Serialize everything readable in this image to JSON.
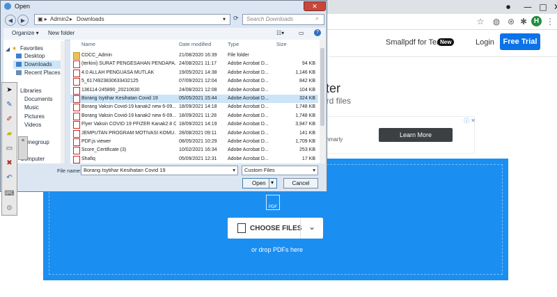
{
  "browser": {
    "window_controls": [
      "—",
      "□",
      "✕"
    ],
    "toolbar_icons": [
      "star-icon",
      "globe-icon",
      "extension-icon",
      "puzzle-icon",
      "menu-icon"
    ],
    "profile_initial": "H"
  },
  "site": {
    "teams_link": "Smallpdf for Teams",
    "new_badge": "New",
    "login": "Login",
    "free_trial": "Free Trial",
    "hero_title": "rter",
    "hero_subtitle": "ord files",
    "ad_text": "mmarly",
    "ad_badge": "ⓘ ✕",
    "learn_more": "Learn More",
    "pdf_glyph_label": "PDF",
    "choose_files": "CHOOSE FILES",
    "drop_hint": "or drop PDFs here",
    "accent_color": "#1b8ef2",
    "trial_color": "#0b72e7"
  },
  "dialog": {
    "title": "Open",
    "close": "✕",
    "address": [
      "Admin2",
      "Downloads"
    ],
    "search_placeholder": "Search Downloads",
    "organize": "Organize ▾",
    "new_folder": "New folder",
    "nav": [
      "Favorites",
      "Desktop",
      "Downloads",
      "Recent Places",
      "Libraries",
      "Documents",
      "Music",
      "Pictures",
      "Videos",
      "Homegroup",
      "Computer"
    ],
    "columns": [
      "Name",
      "Date modified",
      "Type",
      "Size"
    ],
    "files": [
      {
        "name": "CDCC_Admin",
        "date": "21/08/2020 16:39",
        "type": "File folder",
        "size": "",
        "kind": "folder"
      },
      {
        "name": "(terkini) SURAT PENGESAHAN PENDAPA...",
        "date": "24/08/2021 11:17",
        "type": "Adobe Acrobat D...",
        "size": "94 KB",
        "kind": "pdf"
      },
      {
        "name": "4.0 ALLAH PENGUASA MUTLAK",
        "date": "19/05/2021 14:38",
        "type": "Adobe Acrobat D...",
        "size": "1,146 KB",
        "kind": "pdf"
      },
      {
        "name": "5_6174923830633432125",
        "date": "07/09/2021 12:04",
        "type": "Adobe Acrobat D...",
        "size": "842 KB",
        "kind": "pdf"
      },
      {
        "name": "136114-245890_20210630",
        "date": "24/08/2021 12:08",
        "type": "Adobe Acrobat D...",
        "size": "104 KB",
        "kind": "pdf"
      },
      {
        "name": "Borang Isytihar Kesihatan Covid 19",
        "date": "05/05/2021 15:44",
        "type": "Adobe Acrobat D...",
        "size": "324 KB",
        "kind": "pdf",
        "selected": true
      },
      {
        "name": "Borang Vaksin Covid-19 kanak2 new 6-09...",
        "date": "18/09/2021 14:18",
        "type": "Adobe Acrobat D...",
        "size": "1,748 KB",
        "kind": "pdf"
      },
      {
        "name": "Borang Vaksin Covid-19 kanak2 new 6-09...",
        "date": "18/09/2021 11:28",
        "type": "Adobe Acrobat D...",
        "size": "1,748 KB",
        "kind": "pdf"
      },
      {
        "name": "Flyer Vaksin COVID 19 PFIZER Kanak2 8 O...",
        "date": "18/09/2021 14:19",
        "type": "Adobe Acrobat D...",
        "size": "3,947 KB",
        "kind": "pdf"
      },
      {
        "name": "JEMPUTAN PROGRAM MOTIVASI KOMU...",
        "date": "28/08/2021 09:11",
        "type": "Adobe Acrobat D...",
        "size": "141 KB",
        "kind": "pdf"
      },
      {
        "name": "PDF.js viewer",
        "date": "08/05/2021 10:29",
        "type": "Adobe Acrobat D...",
        "size": "1,709 KB",
        "kind": "pdf"
      },
      {
        "name": "Score_Certificate (3)",
        "date": "10/02/2021 16:34",
        "type": "Adobe Acrobat D...",
        "size": "253 KB",
        "kind": "pdf"
      },
      {
        "name": "Shafiq",
        "date": "05/09/2021 12:31",
        "type": "Adobe Acrobat D...",
        "size": "17 KB",
        "kind": "pdf"
      }
    ],
    "filename_label": "File name:",
    "filename_value": "Borang Isytihar Kesihatan Covid 19",
    "filetype": "Custom Files",
    "open": "Open",
    "cancel": "Cancel"
  },
  "draw_toolbar": {
    "tools": [
      "cursor-icon",
      "pen-icon",
      "eraser-icon",
      "highlighter-icon",
      "shape-icon",
      "clear-icon",
      "undo-icon",
      "keyboard-icon",
      "settings-icon"
    ]
  }
}
